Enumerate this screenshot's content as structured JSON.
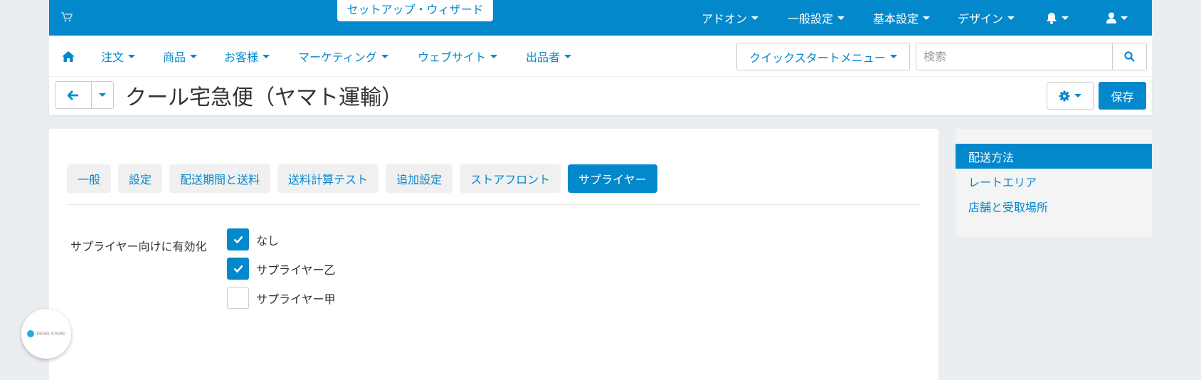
{
  "topbar": {
    "setup_wizard": "セットアップ・ウィザード",
    "menus": [
      "アドオン",
      "一般設定",
      "基本設定",
      "デザイン"
    ]
  },
  "navbar": {
    "items": [
      "注文",
      "商品",
      "お客様",
      "マーケティング",
      "ウェブサイト",
      "出品者"
    ],
    "quickstart": "クイックスタートメニュー",
    "search_placeholder": "検索"
  },
  "page": {
    "title": "クール宅急便（ヤマト運輸）",
    "save_label": "保存"
  },
  "tabs": [
    "一般",
    "設定",
    "配送期間と送料",
    "送料計算テスト",
    "追加設定",
    "ストアフロント",
    "サプライヤー"
  ],
  "active_tab": "サプライヤー",
  "form": {
    "label": "サプライヤー向けに有効化",
    "options": [
      {
        "label": "なし",
        "checked": true
      },
      {
        "label": "サプライヤー乙",
        "checked": true
      },
      {
        "label": "サプライヤー甲",
        "checked": false
      }
    ]
  },
  "sidebar": {
    "items": [
      "配送方法",
      "レートエリア",
      "店舗と受取場所"
    ]
  },
  "badge": {
    "text": "DEMO STORE"
  },
  "colors": {
    "primary": "#0388cc",
    "background": "#ebeef1"
  }
}
